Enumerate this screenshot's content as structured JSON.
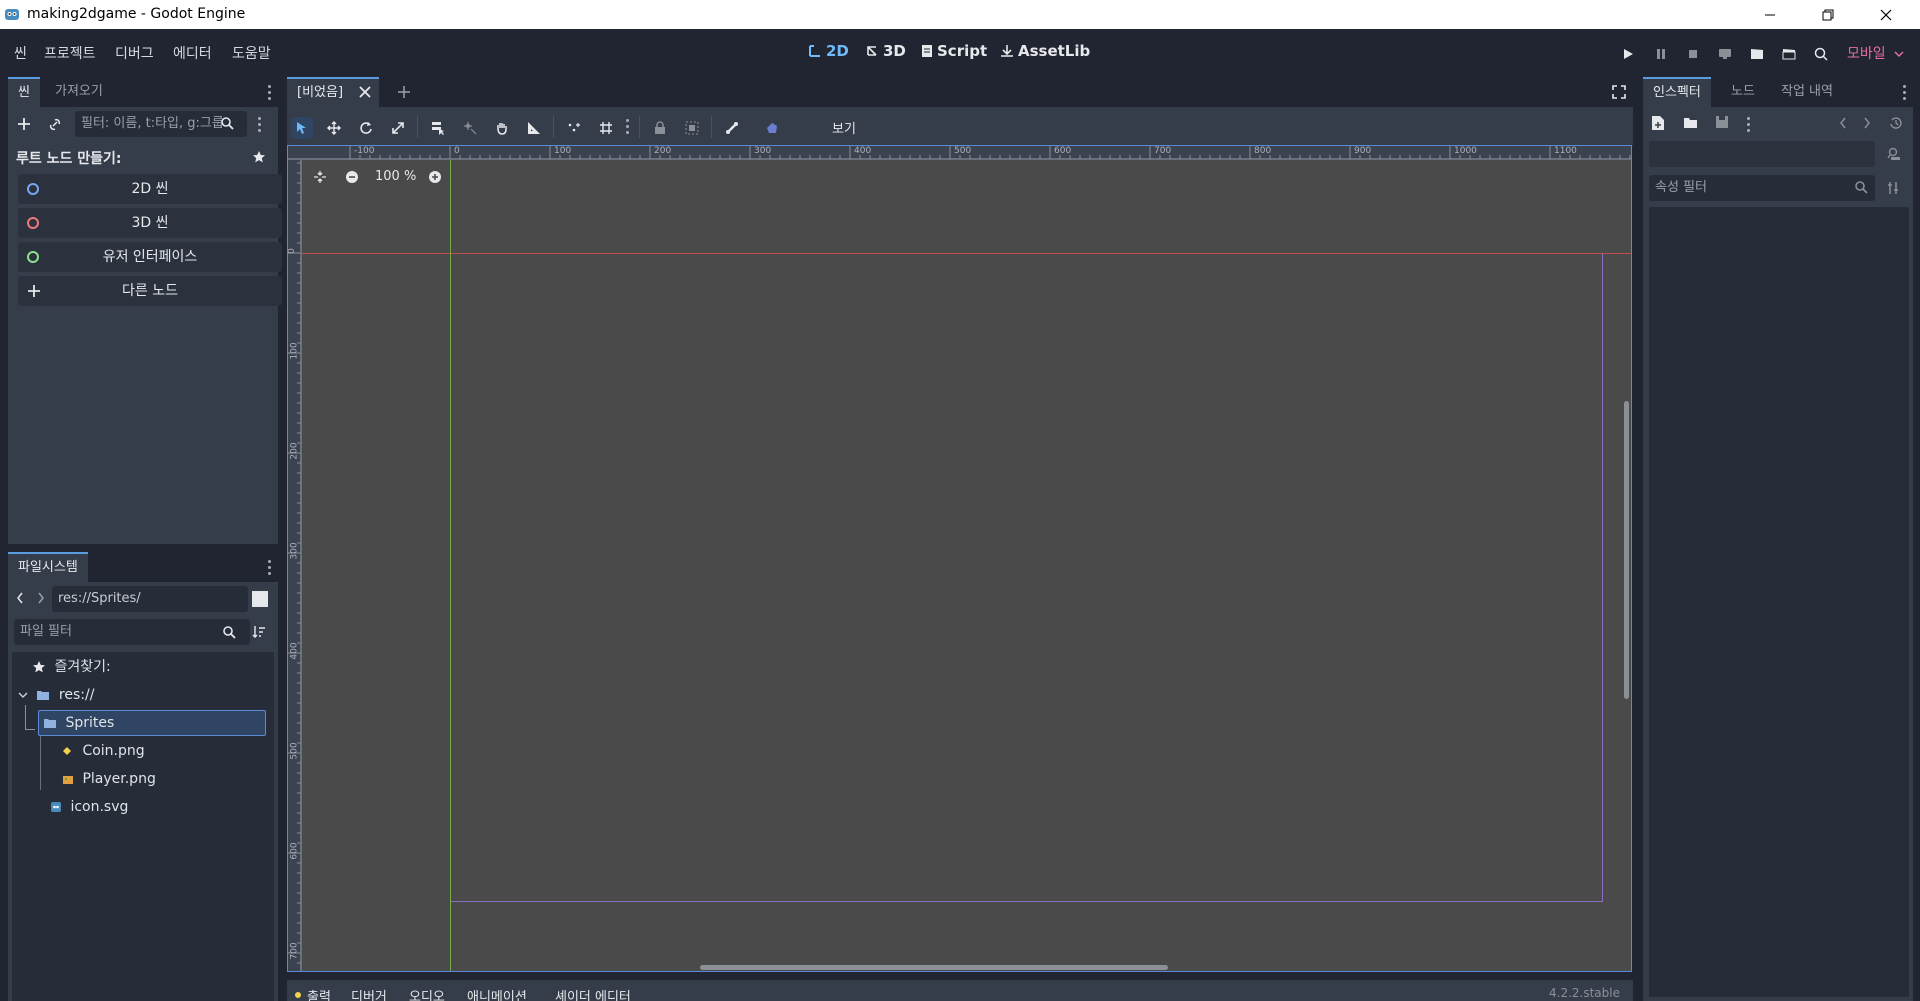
{
  "window": {
    "title": "making2dgame - Godot Engine"
  },
  "menu": {
    "items": [
      "씬",
      "프로젝트",
      "디버그",
      "에디터",
      "도움말"
    ]
  },
  "modes": {
    "m2d": "2D",
    "m3d": "3D",
    "script": "Script",
    "assetlib": "AssetLib"
  },
  "renderer": "모바일",
  "scene_dock": {
    "tabs": [
      "씬",
      "가져오기"
    ],
    "filter_placeholder": "필터: 이름, t:타입, g:그룹",
    "root_label": "루트 노드 만들기:",
    "buttons": [
      "2D 씬",
      "3D 씬",
      "유저 인터페이스",
      "다른 노드"
    ],
    "button_colors": [
      "#7aa6f0",
      "#f07a7a",
      "#8ee08e",
      "#e6e8ec"
    ]
  },
  "filesystem": {
    "tab": "파일시스템",
    "path": "res://Sprites/",
    "filter_placeholder": "파일 필터",
    "favorites": "즐겨찾기:",
    "root": "res://",
    "folder": "Sprites",
    "files": [
      "Coin.png",
      "Player.png"
    ],
    "root_file": "icon.svg"
  },
  "editor": {
    "tab_label": "[비었음]",
    "view_menu": "보기",
    "zoom": "100 %",
    "ruler_top": [
      "-100",
      "0",
      "100",
      "200",
      "300",
      "400",
      "500",
      "600",
      "700",
      "800",
      "900",
      "1000",
      "1100"
    ],
    "ruler_left": [
      "0",
      "100",
      "200",
      "300",
      "400",
      "500",
      "600",
      "700"
    ]
  },
  "inspector": {
    "tabs": [
      "인스펙터",
      "노드",
      "작업 내역"
    ],
    "filter_placeholder": "속성 필터"
  },
  "bottom": {
    "tabs": [
      "출력",
      "디버거",
      "오디오",
      "애니메이션",
      "셰이더 에디터"
    ],
    "version": "4.2.2.stable"
  },
  "colors": {
    "accent": "#70bafa",
    "renderer": "#e56f9e",
    "x_axis": "#e05050",
    "y_axis": "#8bd24a",
    "viewport_bg": "#4a4a4a"
  }
}
